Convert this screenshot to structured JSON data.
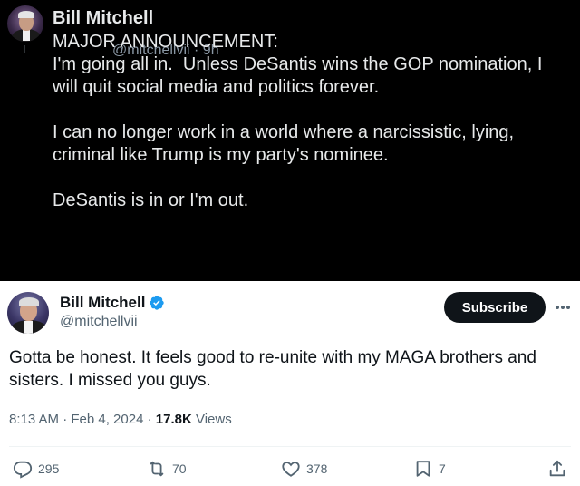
{
  "quoted_post": {
    "display_name": "Bill Mitchell",
    "handle_time": "@mitchellvii · 9h",
    "body": "MAJOR ANNOUNCEMENT:\nI'm going all in.  Unless DeSantis wins the GOP nomination, I will quit social media and politics forever.\n\nI can no longer work in a world where a narcissistic, lying, criminal like Trump is my party's nominee.\n\nDeSantis is in or I'm out."
  },
  "post": {
    "display_name": "Bill Mitchell",
    "handle": "@mitchellvii",
    "subscribe_label": "Subscribe",
    "text": "Gotta be honest.  It feels good to re-unite with my MAGA brothers and sisters.  I missed you guys.",
    "timestamp": "8:13 AM · Feb 4, 2024 · ",
    "views_count": "17.8K",
    "views_label": " Views"
  },
  "actions": {
    "replies": "295",
    "reposts": "70",
    "likes": "378",
    "bookmarks": "7"
  },
  "colors": {
    "verified_badge": "#1d9bf0",
    "secondary_text": "#536471",
    "button_bg": "#0f1419"
  },
  "icons": [
    "verified-icon",
    "more-icon",
    "reply-icon",
    "repost-icon",
    "like-icon",
    "bookmark-icon",
    "share-icon"
  ]
}
